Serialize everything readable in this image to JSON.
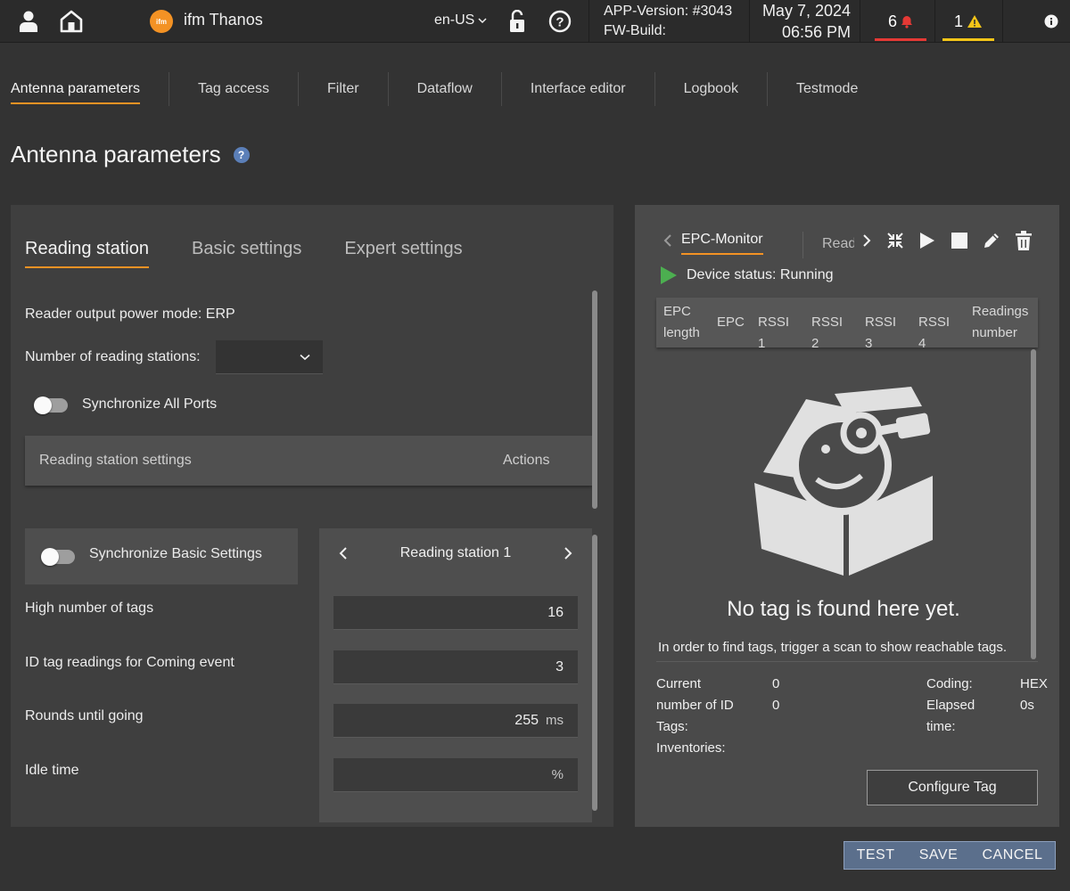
{
  "header": {
    "app_name": "ifm Thanos",
    "logo_text": "ifm",
    "language": "en-US",
    "app_version": "APP-Version: #3043",
    "fw_build": "FW-Build:",
    "date": "May 7, 2024",
    "time": "06:56 PM",
    "alarm_count": "6",
    "warning_count": "1",
    "colors": {
      "accent": "#f39224",
      "alarm": "#e53935",
      "warning": "#f5c518"
    }
  },
  "nav": {
    "tabs": [
      {
        "label": "Antenna parameters"
      },
      {
        "label": "Tag access"
      },
      {
        "label": "Filter"
      },
      {
        "label": "Dataflow"
      },
      {
        "label": "Interface editor"
      },
      {
        "label": "Logbook"
      },
      {
        "label": "Testmode"
      }
    ]
  },
  "page": {
    "title": "Antenna parameters",
    "help_icon": "question-icon"
  },
  "left": {
    "subtabs": [
      {
        "label": "Reading station"
      },
      {
        "label": "Basic settings"
      },
      {
        "label": "Expert settings"
      }
    ],
    "output_power": "Reader output power mode: ERP",
    "num_stations_label": "Number of reading stations:",
    "num_stations_value": "",
    "sync_all": "Synchronize All Ports",
    "table": {
      "col_settings": "Reading station settings",
      "col_actions": "Actions"
    },
    "sync_basic": "Synchronize Basic Settings",
    "station_nav": "Reading station 1",
    "fields": [
      {
        "label": "High number of tags",
        "value": "16",
        "unit": ""
      },
      {
        "label": "ID tag readings for Coming event",
        "value": "3",
        "unit": ""
      },
      {
        "label": "Rounds until going",
        "value": "255",
        "unit": "ms"
      },
      {
        "label": "Idle time",
        "value": "",
        "unit": "%"
      }
    ]
  },
  "right": {
    "tab_active": "EPC-Monitor",
    "tab_next": "Read",
    "device_status": "Device status: Running",
    "columns": [
      "EPC length",
      "EPC",
      "RSSI 1",
      "RSSI 2",
      "RSSI 3",
      "RSSI 4",
      "Readings number"
    ],
    "empty_title": "No tag is found here yet.",
    "empty_sub": "In order to find tags, trigger a scan to show reachable tags.",
    "stats": {
      "current_label": "Current number of ID Tags:",
      "current_value": "0",
      "inventories_label": "Inventories:",
      "inventories_value": "0",
      "coding_label": "Coding:",
      "coding_value": "HEX",
      "elapsed_label": "Elapsed time:",
      "elapsed_value": "0s"
    },
    "configure_button": "Configure Tag"
  },
  "footer": {
    "test": "TEST",
    "save": "SAVE",
    "cancel": "CANCEL"
  }
}
